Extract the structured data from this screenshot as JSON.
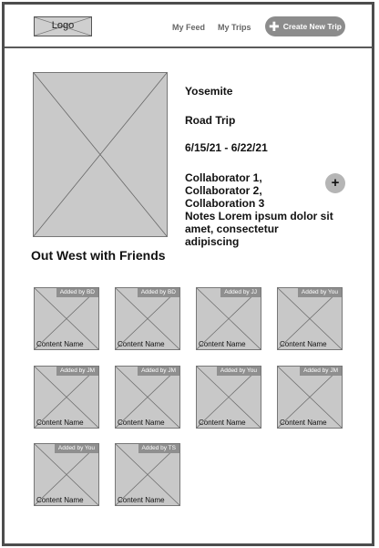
{
  "header": {
    "logo_label": "Logo",
    "nav": [
      {
        "label": "My Feed"
      },
      {
        "label": "My Trips"
      }
    ],
    "create_button": {
      "label": "Create New Trip",
      "icon": "plus-icon"
    }
  },
  "trip": {
    "title": "Yosemite",
    "type": "Road Trip",
    "dates": "6/15/21 - 6/22/21",
    "collaborators": "Collaborator 1, Collaborator 2, Collaboration 3",
    "notes": "Notes Lorem ipsum dolor sit amet, consectetur adipiscing",
    "add_collaborator_icon": "plus-icon"
  },
  "album": {
    "title": "Out West with Friends",
    "items": [
      {
        "badge": "Added by BD",
        "name": "Content Name"
      },
      {
        "badge": "Added by BD",
        "name": "Content Name"
      },
      {
        "badge": "Added by JJ",
        "name": "Content Name"
      },
      {
        "badge": "Added by You",
        "name": "Content Name"
      },
      {
        "badge": "Added by JM",
        "name": "Content Name"
      },
      {
        "badge": "Added by JM",
        "name": "Content Name"
      },
      {
        "badge": "Added by You",
        "name": "Content Name"
      },
      {
        "badge": "Added by JM",
        "name": "Content Name"
      },
      {
        "badge": "Added by You",
        "name": "Content Name"
      },
      {
        "badge": "Added by TS",
        "name": "Content Name"
      }
    ]
  },
  "colors": {
    "border": "#4d4d4d",
    "placeholder": "#c8c8c8",
    "button": "#8c8c8c",
    "badge": "#8f8f8f"
  }
}
